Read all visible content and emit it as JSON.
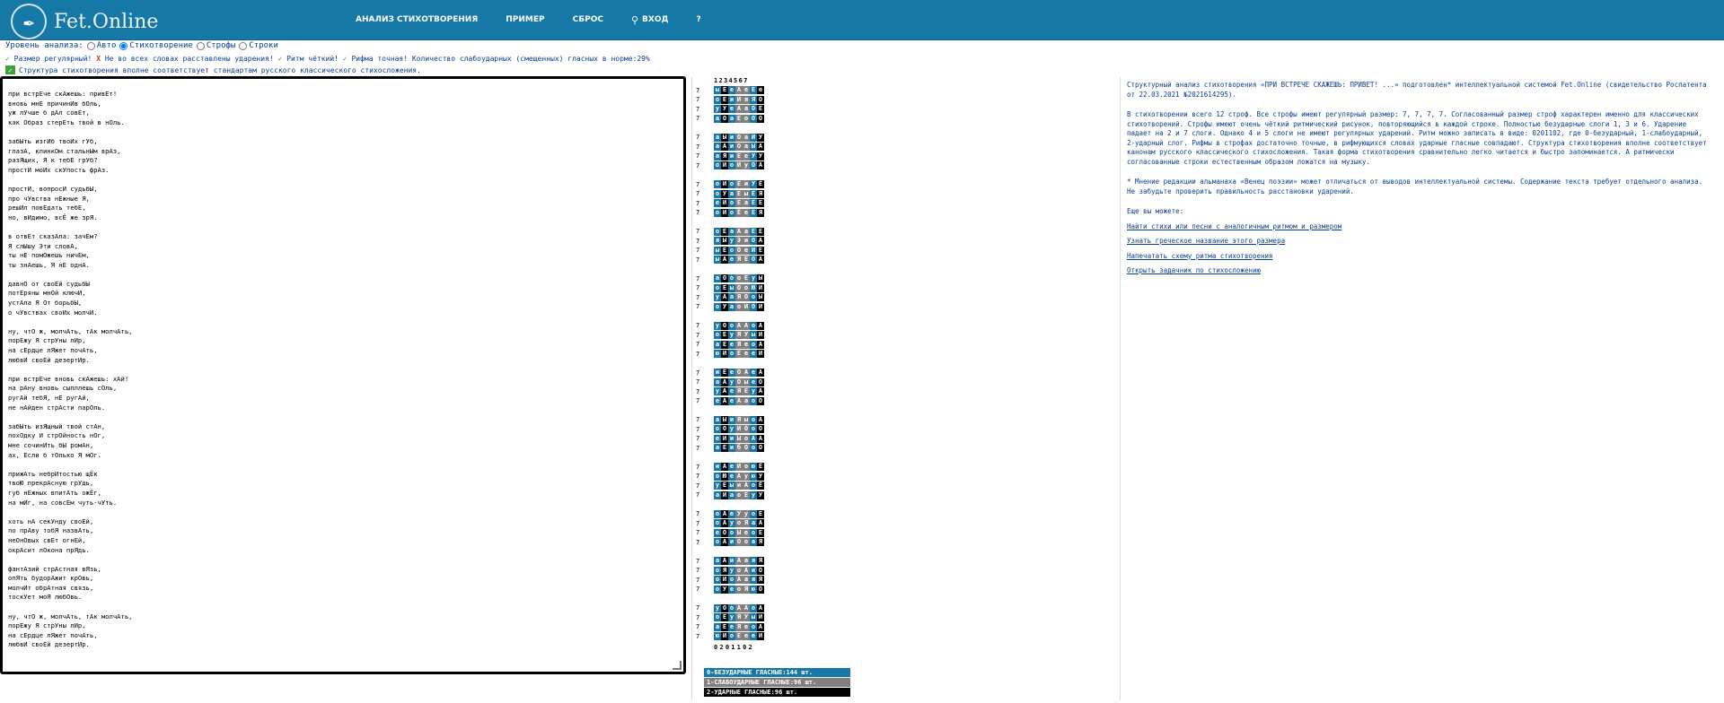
{
  "header": {
    "brand": "Fet.Online",
    "menu": [
      "АНАЛИЗ СТИХОТВОРЕНИЯ",
      "ПРИМЕР",
      "СБРОС",
      "ВХОД",
      "?"
    ]
  },
  "analysis": {
    "label": "Уровень анализа:",
    "options": [
      "Авто",
      "Стихотворение",
      "Строфы",
      "Строки"
    ],
    "selected": "Стихотворение"
  },
  "status": {
    "check1": "Размер регулярный!",
    "cross": "Не во всех словах расставлены ударения!",
    "check2": "Ритм чёткий!",
    "check3": "Рифма точная! Количество слабоударных (смещенных) гласных в норме:29%",
    "structure": "Структура стихотворения вполне соответствует стандартам русского классического стихосложения."
  },
  "poem": "при встрЕче скАжешь: привЕт!\nвновь мнЕ причинИв бОль,\nуж лУчше б дАл совЕт,\nкак Образ стерЕть твой в нОль.\n\nзабЫть изгИб твоИх гУб,\nглазА, клинкОм стальнЫм врАз,\nразЯщих, Я к тебЕ грУб?\nпростИ моИх скУпость фрАз.\n\nпростИ, вопросИ судьбЫ,\nпро чУвства нЕжные Я,\nрешИл повЕдать тебЕ,\nно, вИдимо, всЁ же зрЯ.\n\nв отвЕт сказАла: зачЕм?\nЯ слЫшу Эти словА,\nты нЕ помОжешь ничЕм,\nты знАешь, Я нЕ однА.\n\nдавнО от своЕй судьбЫ\nпотЕряны мнОй ключИ,\nустАла Я От борьбЫ,\nо чУвствах своИх молчИ.\n\nну, чтО ж, молчАть, тАк молчАть,\nпорЕжу Я стрУны лИр,\nна сЕрдце лЯжет почАть,\nлюбвИ своЕй дезертИр.\n\nпри встрЕче вновь скАжешь: хАй!\nна рАну вновь сыпллешь сОль,\nругАй тебЯ, нЕ ругАй,\nне нАйден стрАсти парОль.\n\nзабЫть изЯщный твой стАн,\nпохОдку И стрОйность нОг,\nмне сочинИть бЫ ромАн,\nах, Если б тОлько Я мОг.\n\nприжАть небрИтостью щЁк\nтвоЮ прекрАсную грУдь,\nгуб нЕжных впитАть ожЁг,\nна мИг, на совсЕм чуть-чУть.\n\nхоть нА секУнду своЕй,\nпо прАву тобЯ назвАть,\nнеОнОвых свЕт огнЕй,\nокрАсит лОкона прЯдь.\n\nфантАзий стрАстная вЯзь,\nопЯть будорАжит крОвь,\nмолчИт обрАтная связь,\nтоскУет моЯ любОвь.\n\nну, чтО ж, молчАть, тАк молчАть,\nпорЕжу Я стрУны лИр,\nна сЕрдце лЯжет почАть,\nлюбвИ своЕй дезертИр.",
  "grid": {
    "colnums": "1234567",
    "row_number": "7",
    "stanzas": [
      [
        [
          "ы",
          "Е",
          "е",
          "А",
          "е",
          "Е",
          "е"
        ],
        [
          "о",
          "Е",
          "и",
          "И",
          "я",
          "Я",
          "О"
        ],
        [
          "у",
          "У",
          "е",
          "А",
          "а",
          "О",
          "Е"
        ],
        [
          "а",
          "О",
          "а",
          "Е",
          "о",
          "О",
          "О"
        ]
      ],
      [
        [
          "а",
          "Ы",
          "и",
          "О",
          "а",
          "И",
          "У"
        ],
        [
          "а",
          "А",
          "и",
          "О",
          "а",
          "Ы",
          "А"
        ],
        [
          "а",
          "Я",
          "и",
          "Е",
          "е",
          "У",
          "У"
        ],
        [
          "о",
          "И",
          "о",
          "И",
          "у",
          "О",
          "А"
        ]
      ],
      [
        [
          "о",
          "И",
          "о",
          "Е",
          "и",
          "У",
          "Ё"
        ],
        [
          "о",
          "У",
          "а",
          "Е",
          "ы",
          "Е",
          "Я"
        ],
        [
          "е",
          "И",
          "о",
          "Е",
          "а",
          "Е",
          "Е"
        ],
        [
          "о",
          "И",
          "о",
          "Ё",
          "е",
          "Е",
          "Я"
        ]
      ],
      [
        [
          "о",
          "Е",
          "а",
          "А",
          "а",
          "Е",
          "Е"
        ],
        [
          "я",
          "Ы",
          "у",
          "Э",
          "и",
          "О",
          "А"
        ],
        [
          "ы",
          "Е",
          "о",
          "О",
          "е",
          "И",
          "Е"
        ],
        [
          "ы",
          "А",
          "е",
          "Я",
          "Е",
          "О",
          "А"
        ]
      ],
      [
        [
          "а",
          "О",
          "о",
          "о",
          "Е",
          "у",
          "Ы"
        ],
        [
          "о",
          "Е",
          "ы",
          "О",
          "о",
          "Ю",
          "И"
        ],
        [
          "у",
          "А",
          "а",
          "Я",
          "О",
          "о",
          "Ы"
        ],
        [
          "о",
          "У",
          "а",
          "о",
          "И",
          "О",
          "И"
        ]
      ],
      [
        [
          "у",
          "О",
          "о",
          "А",
          "А",
          "о",
          "А"
        ],
        [
          "о",
          "Е",
          "у",
          "Я",
          "У",
          "ы",
          "И"
        ],
        [
          "а",
          "Е",
          "е",
          "Я",
          "е",
          "о",
          "А"
        ],
        [
          "ю",
          "И",
          "о",
          "Е",
          "е",
          "е",
          "И"
        ]
      ],
      [
        [
          "и",
          "Е",
          "е",
          "О",
          "А",
          "е",
          "А"
        ],
        [
          "а",
          "А",
          "у",
          "О",
          "ы",
          "е",
          "О"
        ],
        [
          "у",
          "А",
          "е",
          "Я",
          "Е",
          "у",
          "А"
        ],
        [
          "е",
          "А",
          "е",
          "А",
          "а",
          "о",
          "О"
        ]
      ],
      [
        [
          "а",
          "Ы",
          "и",
          "Я",
          "ы",
          "о",
          "А"
        ],
        [
          "о",
          "О",
          "у",
          "И",
          "О",
          "о",
          "О"
        ],
        [
          "е",
          "И",
          "и",
          "Ы",
          "о",
          "А",
          "А"
        ],
        [
          "а",
          "Е",
          "и",
          "б",
          "О",
          "о",
          "О"
        ]
      ],
      [
        [
          "и",
          "А",
          "е",
          "И",
          "о",
          "ю",
          "Ё"
        ],
        [
          "о",
          "Ю",
          "е",
          "А",
          "у",
          "ю",
          "У"
        ],
        [
          "у",
          "Е",
          "ы",
          "и",
          "А",
          "о",
          "Ё"
        ],
        [
          "а",
          "И",
          "а",
          "о",
          "Е",
          "у",
          "У"
        ]
      ],
      [
        [
          "о",
          "А",
          "е",
          "У",
          "у",
          "о",
          "Е"
        ],
        [
          "о",
          "А",
          "у",
          "о",
          "Я",
          "а",
          "А"
        ],
        [
          "е",
          "О",
          "о",
          "Ы",
          "е",
          "о",
          "Е"
        ],
        [
          "о",
          "А",
          "и",
          "О",
          "о",
          "а",
          "Я"
        ]
      ],
      [
        [
          "а",
          "А",
          "и",
          "А",
          "а",
          "я",
          "Я"
        ],
        [
          "о",
          "Я",
          "у",
          "о",
          "А",
          "и",
          "О"
        ],
        [
          "о",
          "И",
          "о",
          "А",
          "а",
          "я",
          "Я"
        ],
        [
          "о",
          "У",
          "е",
          "о",
          "Я",
          "ю",
          "О"
        ]
      ],
      [
        [
          "у",
          "О",
          "о",
          "А",
          "А",
          "о",
          "А"
        ],
        [
          "о",
          "Е",
          "у",
          "Я",
          "У",
          "ы",
          "И"
        ],
        [
          "а",
          "Е",
          "е",
          "Я",
          "е",
          "о",
          "А"
        ],
        [
          "ю",
          "И",
          "о",
          "Е",
          "е",
          "е",
          "И"
        ]
      ]
    ],
    "bottom": "0201102"
  },
  "legend": {
    "l0": "0-БЕЗУДАРНЫЕ ГЛАСНЫЕ:144 шт.",
    "l1": "1-СЛАБОУДАРНЫЕ ГЛАСНЫЕ:96 шт.",
    "l2": "2-УДАРНЫЕ ГЛАСНЫЕ:96 шт."
  },
  "right": {
    "intro": "Структурный анализ стихотворения «ПРИ ВСТРЕЧЕ СКАЖЕШЬ: ПРИВЕТ! ...» подготовлен* интеллектуальной системой Fet.Online (свидетельство Роспатента от 22.03.2021 №2021614295).",
    "body": "В стихотворении всего 12 строф. Все строфы имеют регулярный размер: 7, 7, 7, 7. Согласованный размер строф характерен именно для классических стихотворений. Строфы имеют очень чёткий ритмический рисунок, повторяющийся в каждой строке. Полностью безударные слоги 1, 3 и 6. Ударение падает на 2 и 7 слоги. Однако 4 и 5 слоги не имеют регулярных ударений. Ритм можно записать в виде: 0201102, где 0-безударный, 1-слабоударный, 2-ударный слог. Рифмы в строфах достаточно точные, в рифмующихся словах ударные гласные совпадают. Структура стихотворения вполне соответствует канонам русского классического стихосложения. Такая форма стихотворения сравнительно легко читается и быстро запоминается. А ритмически согласованные строки естественным образом ложатся на музыку.",
    "note": "* Мнение редакции альманаха «Венец поэзии» может отличаться от выводов интеллектуальной системы. Содержание текста требует отдельного анализа. Не забудьте проверить правильность расстановки ударений.",
    "tip": "Еще вы можете:",
    "links": [
      "Найти стихи или песни с аналогичным ритмом и размером",
      "Узнать греческое название этого размера",
      "Напечатать схему ритма стихотворения",
      "Открыть задачник по стихосложению"
    ]
  }
}
